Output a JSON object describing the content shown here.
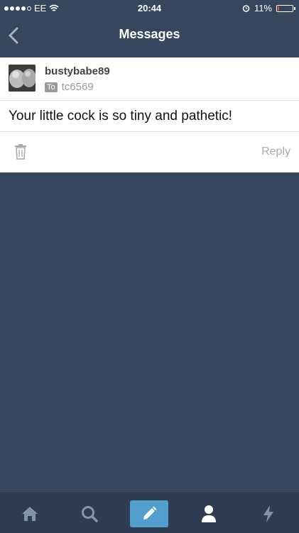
{
  "status_bar": {
    "carrier": "EE",
    "time": "20:44",
    "battery_percent": "11%",
    "battery_level": 0.11,
    "signal_bars_filled": 4,
    "signal_bars_total": 5
  },
  "nav": {
    "title": "Messages"
  },
  "message": {
    "sender": "bustybabe89",
    "to_label": "To",
    "recipient": "tc6569",
    "body": "Your little cock is so tiny and pathetic!",
    "reply_label": "Reply"
  },
  "tabs": [
    {
      "icon": "home-icon"
    },
    {
      "icon": "search-icon"
    },
    {
      "icon": "compose-icon"
    },
    {
      "icon": "account-icon"
    },
    {
      "icon": "activity-icon"
    }
  ],
  "colors": {
    "background": "#36465d",
    "tab_bar": "#2f3d52",
    "compose_accent": "#529ecc",
    "card": "#ffffff",
    "battery_low": "#ff3b30"
  }
}
